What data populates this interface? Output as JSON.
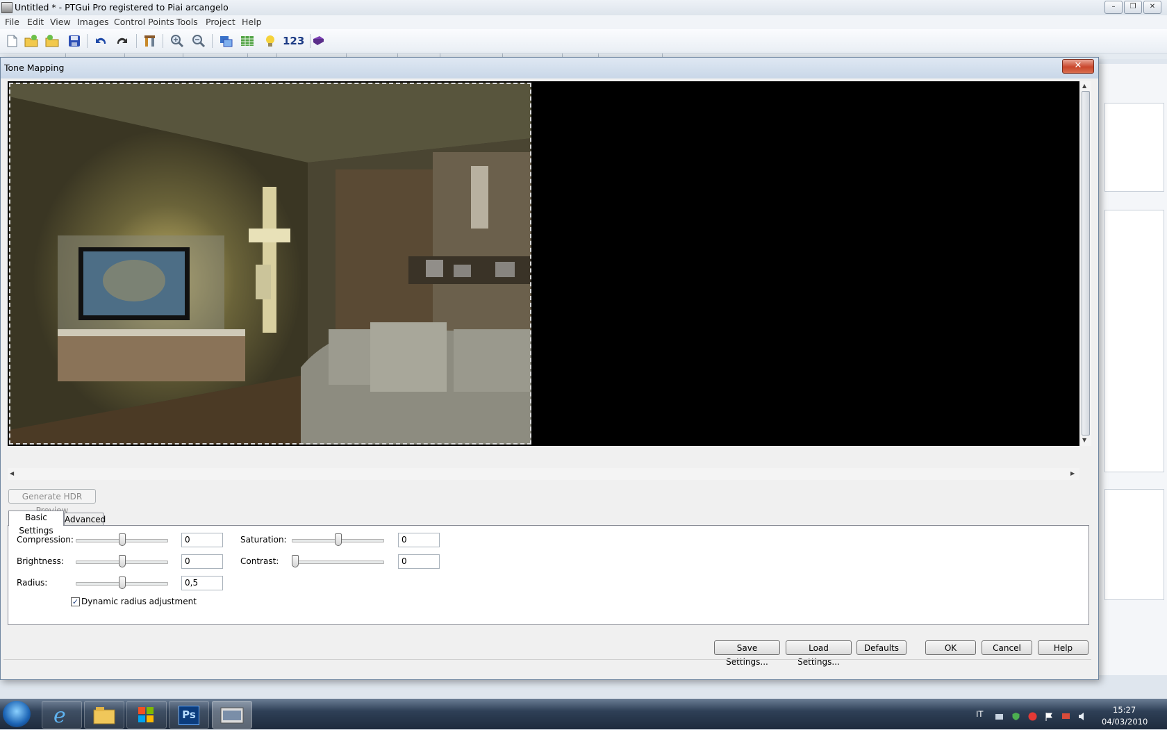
{
  "window": {
    "title": "Untitled * - PTGui Pro registered to Piai arcangelo",
    "controls": [
      "minimize-icon",
      "restore-icon",
      "close-icon"
    ]
  },
  "menu": [
    "File",
    "Edit",
    "View",
    "Images",
    "Control Points",
    "Tools",
    "Project",
    "Help"
  ],
  "toolbar": {
    "icons": [
      "new-icon",
      "open-icon",
      "open-recent-icon",
      "save-icon",
      "undo-icon",
      "redo-icon",
      "tools-icon",
      "zoom-in-icon",
      "zoom-out-icon",
      "panorama-editor-icon",
      "table-icon",
      "lightbulb-icon",
      "numbers-icon",
      "batch-icon"
    ],
    "numbers_label": "123"
  },
  "dialog": {
    "title": "Tone Mapping",
    "close_label": "✕",
    "generate_button": "Generate HDR Preview",
    "tabs": [
      {
        "label": "Basic Settings",
        "active": true
      },
      {
        "label": "Advanced",
        "active": false
      }
    ],
    "settings": {
      "compression": {
        "label": "Compression:",
        "value": "0",
        "level": 0.5
      },
      "brightness": {
        "label": "Brightness:",
        "value": "0",
        "level": 0.5
      },
      "radius": {
        "label": "Radius:",
        "value": "0,5",
        "level": 0.5
      },
      "saturation": {
        "label": "Saturation:",
        "value": "0",
        "level": 0.5
      },
      "contrast": {
        "label": "Contrast:",
        "value": "0",
        "level": 0.0
      }
    },
    "dynamic_radius": {
      "label": "Dynamic radius adjustment",
      "checked": true
    },
    "buttons": {
      "save": "Save Settings...",
      "load": "Load Settings...",
      "defaults": "Defaults",
      "ok": "OK",
      "cancel": "Cancel",
      "help": "Help"
    }
  },
  "taskbar": {
    "apps": [
      "start-icon",
      "internet-explorer-icon",
      "explorer-icon",
      "windows-app-icon",
      "photoshop-icon",
      "ptgui-icon"
    ],
    "photoshop_label": "Ps",
    "language": "IT",
    "time": "15:27",
    "date": "04/03/2010"
  },
  "colors": {
    "accent": "#1c64b5",
    "dialog_bg": "#f0f0f0",
    "close_red": "#c9462c"
  }
}
